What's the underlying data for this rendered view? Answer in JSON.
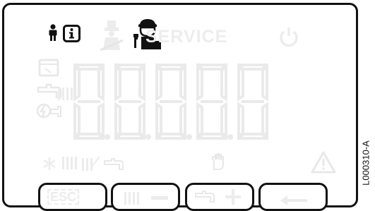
{
  "display": {
    "service_label": "SERVICE",
    "digits": [
      "8",
      "8",
      "8",
      "8",
      "8"
    ]
  },
  "keys": [
    {
      "label": "ESC"
    },
    {
      "label": ""
    },
    {
      "label": ""
    },
    {
      "label": ""
    }
  ],
  "reference_code": "L000310-A",
  "icons": {
    "active": [
      "person-icon",
      "info-icon",
      "service-engineer-icon"
    ],
    "inactive": [
      "chimney-sweep-icon",
      "power-icon",
      "calendar-icon",
      "hot-water-tap-icon",
      "radiator-icon",
      "lightning-icon",
      "frost-icon",
      "floor-heating-icon",
      "manual-hand-icon",
      "warning-icon",
      "minus-icon",
      "plus-icon",
      "enter-arrow-icon"
    ]
  },
  "colors": {
    "active_icon": "#111111",
    "inactive_segment": "#eeeeee",
    "frame": "#111111"
  }
}
